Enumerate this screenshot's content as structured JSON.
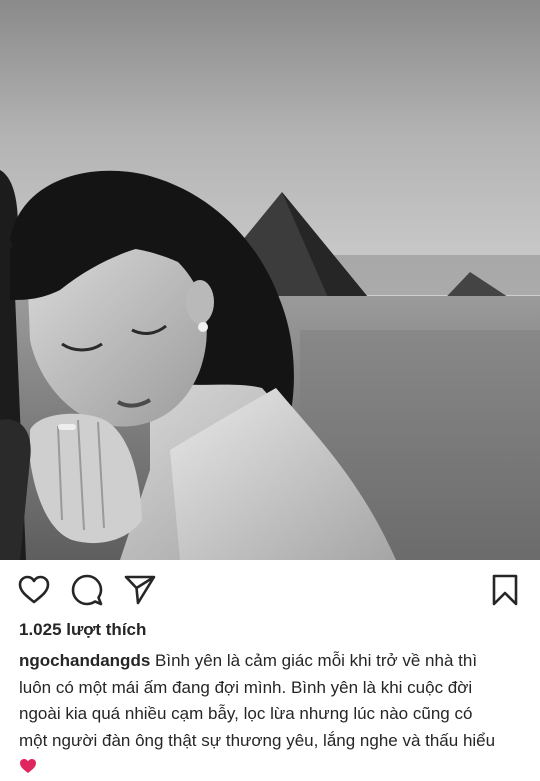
{
  "post": {
    "photo": {
      "subject": "photo-bw",
      "colors": {
        "sky": "#b8b8b8",
        "sand": "#8d8d8d",
        "hair": "#141414"
      }
    },
    "actions": {
      "like_icon": "heart-outline-icon",
      "comment_icon": "comment-bubble-icon",
      "share_icon": "paper-plane-icon",
      "save_icon": "bookmark-icon"
    },
    "likes_text": "1.025 lượt thích",
    "caption": {
      "username": "ngochandangds",
      "lines": [
        "Bình yên là cảm giác mỗi khi trở về nhà thì",
        "luôn có một mái ấm đang đợi mình.  Bình yên là khi cuộc đời",
        "ngoài kia quá nhiều cạm bẫy, lọc lừa nhưng lúc nào cũng có",
        "một người đàn ông thật sự thương yêu, lắng nghe và thấu hiểu"
      ],
      "trailing_emoji": "red-heart-emoji",
      "emoji_color": "#e0245e"
    }
  }
}
